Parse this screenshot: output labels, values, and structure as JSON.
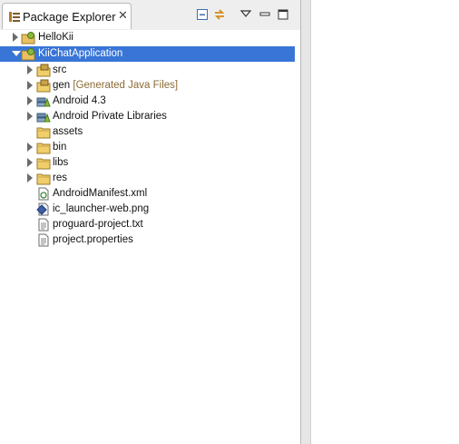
{
  "view": {
    "title": "Package Explorer",
    "close_glyph": "✕"
  },
  "toolbar": {
    "collapse_icon": "collapse-all-icon",
    "link_icon": "link-with-editor-icon",
    "menu_icon": "view-menu-icon",
    "minimize_icon": "minimize-icon",
    "maximize_icon": "maximize-icon"
  },
  "colors": {
    "selection": "#3875d7",
    "decoration": "#8a6a33"
  },
  "tree": {
    "items": [
      {
        "label": "HelloKii",
        "icon": "android-project-icon",
        "state": "collapsed"
      },
      {
        "label": "KiiChatApplication",
        "icon": "android-project-icon",
        "state": "expanded",
        "selected": true
      },
      {
        "label": "src",
        "icon": "source-folder-icon",
        "state": "collapsed"
      },
      {
        "label": "gen",
        "decoration": "[Generated Java Files]",
        "icon": "source-folder-icon",
        "state": "collapsed"
      },
      {
        "label": "Android 4.3",
        "icon": "library-icon",
        "state": "collapsed"
      },
      {
        "label": "Android Private Libraries",
        "icon": "library-icon",
        "state": "collapsed"
      },
      {
        "label": "assets",
        "icon": "folder-icon",
        "state": "leaf"
      },
      {
        "label": "bin",
        "icon": "folder-icon",
        "state": "collapsed"
      },
      {
        "label": "libs",
        "icon": "folder-icon",
        "state": "collapsed"
      },
      {
        "label": "res",
        "icon": "folder-icon",
        "state": "collapsed"
      },
      {
        "label": "AndroidManifest.xml",
        "icon": "xml-file-icon",
        "state": "leaf"
      },
      {
        "label": "ic_launcher-web.png",
        "icon": "image-file-icon",
        "state": "leaf"
      },
      {
        "label": "proguard-project.txt",
        "icon": "text-file-icon",
        "state": "leaf"
      },
      {
        "label": "project.properties",
        "icon": "text-file-icon",
        "state": "leaf"
      }
    ]
  }
}
